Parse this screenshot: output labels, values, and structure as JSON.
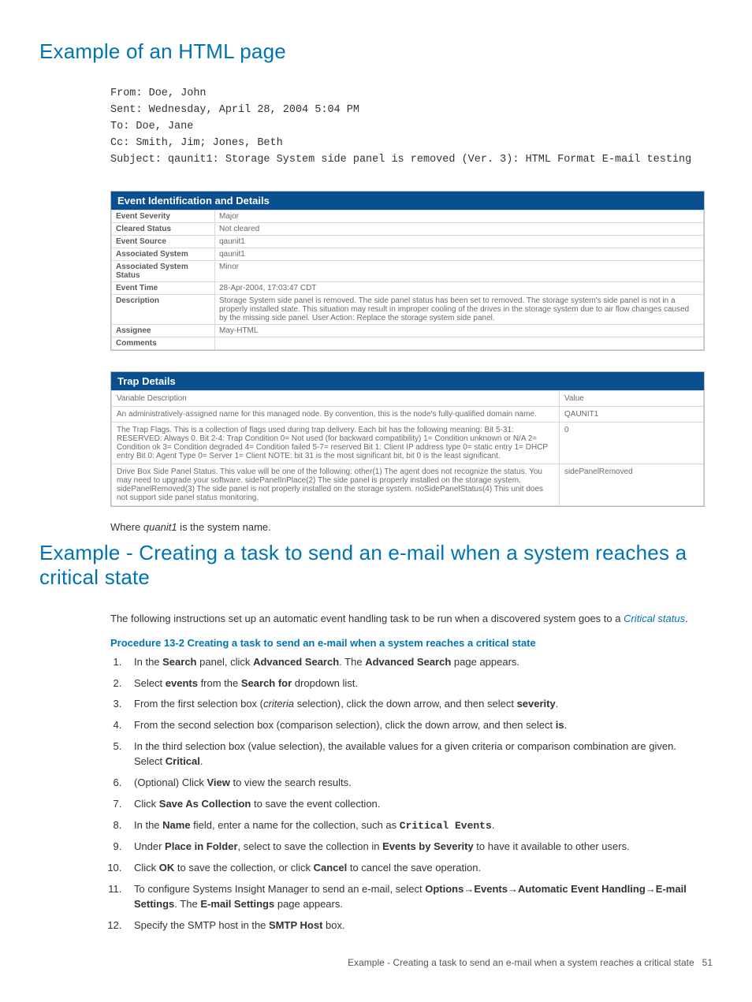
{
  "heading1": "Example of an HTML page",
  "email": {
    "from": "From: Doe, John",
    "sent": "Sent: Wednesday, April 28, 2004 5:04 PM",
    "to": "To: Doe, Jane",
    "cc": "Cc: Smith, Jim; Jones, Beth",
    "subject": "Subject: qaunit1: Storage System side panel is removed (Ver. 3): HTML Format E-mail testing"
  },
  "panel1": {
    "title": "Event Identification and Details",
    "rows": [
      {
        "k": "Event Severity",
        "v": "Major"
      },
      {
        "k": "Cleared Status",
        "v": "Not cleared"
      },
      {
        "k": "Event Source",
        "v": "qaunit1"
      },
      {
        "k": "Associated System",
        "v": "qaunit1"
      },
      {
        "k": "Associated System Status",
        "v": "Minor"
      },
      {
        "k": "Event Time",
        "v": "28-Apr-2004, 17:03:47 CDT"
      },
      {
        "k": "Description",
        "v": "Storage System side panel is removed. The side panel status has been set to removed. The storage system's side panel is not in a properly installed state. This situation may result in improper cooling of the drives in the storage system due to air flow changes caused by the missing side panel. User Action: Replace the storage system side panel."
      },
      {
        "k": "Assignee",
        "v": "May-HTML"
      },
      {
        "k": "Comments",
        "v": ""
      }
    ]
  },
  "panel2": {
    "title": "Trap Details",
    "head_desc": "Variable Description",
    "head_val": "Value",
    "rows": [
      {
        "d": "An administratively-assigned name for this managed node. By convention, this is the node's fully-qualified domain name.",
        "v": "QAUNIT1"
      },
      {
        "d": "The Trap Flags. This is a collection of flags used during trap delivery. Each bit has the following meaning: Bit 5-31: RESERVED: Always 0. Bit 2-4: Trap Condition 0= Not used (for backward compatibility) 1= Condition unknown or N/A 2= Condition ok 3= Condition degraded 4= Condition failed 5-7= reserved Bit 1: Client IP address type 0= static entry 1= DHCP entry Bit 0: Agent Type 0= Server 1= Client NOTE: bit 31 is the most significant bit, bit 0 is the least significant.",
        "v": "0"
      },
      {
        "d": "Drive Box Side Panel Status. This value will be one of the following: other(1) The agent does not recognize the status. You may need to upgrade your software. sidePanelInPlace(2) The side panel is properly installed on the storage system. sidePanelRemoved(3) The side panel is not properly installed on the storage system. noSidePanelStatus(4) This unit does not support side panel status monitoring.",
        "v": "sidePanelRemoved"
      }
    ]
  },
  "where_line_pre": "Where ",
  "where_line_ital": "quanit1",
  "where_line_post": " is the system name.",
  "heading2": "Example - Creating a task to send an e-mail when a system reaches a critical state",
  "intro_p_pre": "The following instructions set up an automatic event handling task to be run when a discovered system goes to a ",
  "intro_p_ital": "Critical status",
  "intro_p_post": ".",
  "proc_title": "Procedure 13-2 Creating a task to send an e-mail when a system reaches a critical state",
  "steps": {
    "s1a": "In the ",
    "s1b": "Search",
    "s1c": " panel, click ",
    "s1d": "Advanced Search",
    "s1e": ". The ",
    "s1f": "Advanced Search",
    "s1g": " page appears.",
    "s2a": "Select ",
    "s2b": "events",
    "s2c": " from the ",
    "s2d": "Search for",
    "s2e": " dropdown list.",
    "s3a": "From the first selection box (",
    "s3b": "criteria",
    "s3c": " selection), click the down arrow, and then select ",
    "s3d": "severity",
    "s3e": ".",
    "s4a": "From the second selection box (comparison selection), click the down arrow, and then select ",
    "s4b": "is",
    "s4c": ".",
    "s5a": "In the third selection box (value selection), the available values for a given criteria or comparison combination are given. Select ",
    "s5b": "Critical",
    "s5c": ".",
    "s6a": "(Optional) Click ",
    "s6b": "View",
    "s6c": " to view the search results.",
    "s7a": "Click ",
    "s7b": "Save As Collection",
    "s7c": " to save the event collection.",
    "s8a": "In the ",
    "s8b": "Name",
    "s8c": " field, enter a name for the collection, such as ",
    "s8d": "Critical Events",
    "s8e": ".",
    "s9a": "Under ",
    "s9b": "Place in Folder",
    "s9c": ", select to save the collection in ",
    "s9d": "Events by Severity",
    "s9e": " to have it available to other users.",
    "s10a": "Click ",
    "s10b": "OK",
    "s10c": " to save the collection, or click ",
    "s10d": "Cancel",
    "s10e": " to cancel the save operation.",
    "s11a": "To configure Systems Insight Manager to send an e-mail, select ",
    "s11b": "Options",
    "s11c": "Events",
    "s11d": "Automatic Event Handling",
    "s11e": "E-mail Settings",
    "s11f": ". The ",
    "s11g": "E-mail Settings",
    "s11h": " page appears.",
    "s12a": "Specify the SMTP host in the ",
    "s12b": "SMTP Host",
    "s12c": " box."
  },
  "arrow": "→",
  "footer_text": "Example - Creating a task to send an e-mail when a system reaches a critical state",
  "footer_page": "51"
}
